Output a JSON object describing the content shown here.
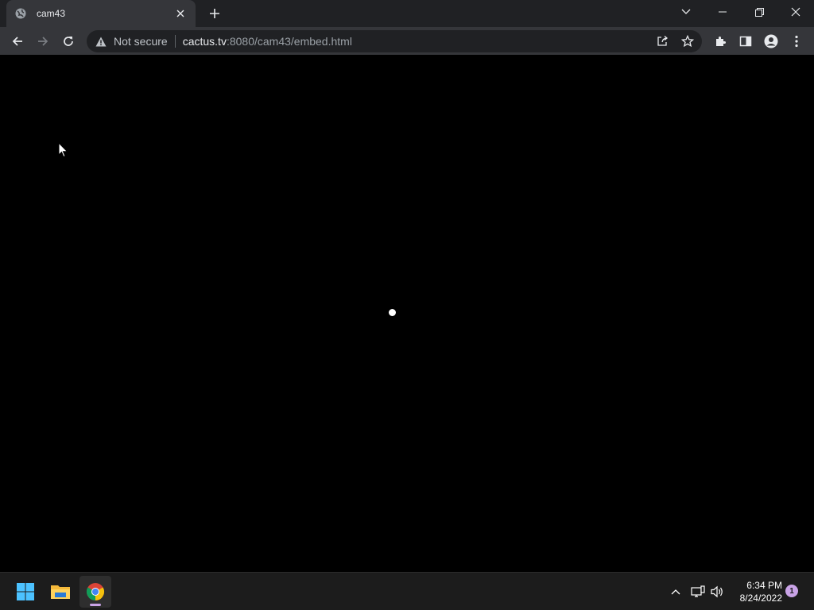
{
  "browser": {
    "tab": {
      "title": "cam43",
      "favicon": "globe-icon"
    },
    "new_tab_icon": "plus-icon",
    "window_controls": [
      "tab-search-icon",
      "minimize-icon",
      "restore-icon",
      "close-icon"
    ]
  },
  "toolbar": {
    "security_label": "Not secure",
    "url_host": "cactus.tv",
    "url_rest": ":8080/cam43/embed.html"
  },
  "taskbar": {
    "apps": [
      "start-icon",
      "file-explorer-icon",
      "chrome-icon"
    ],
    "time": "6:34 PM",
    "date": "8/24/2022",
    "notification_count": "1"
  },
  "colors": {
    "tab_active": "#35363a",
    "tabstrip": "#202124",
    "omnibox": "#202124",
    "content_bg": "#000000",
    "taskbar": "#1c1c1c",
    "accent": "#c9a3e6"
  }
}
